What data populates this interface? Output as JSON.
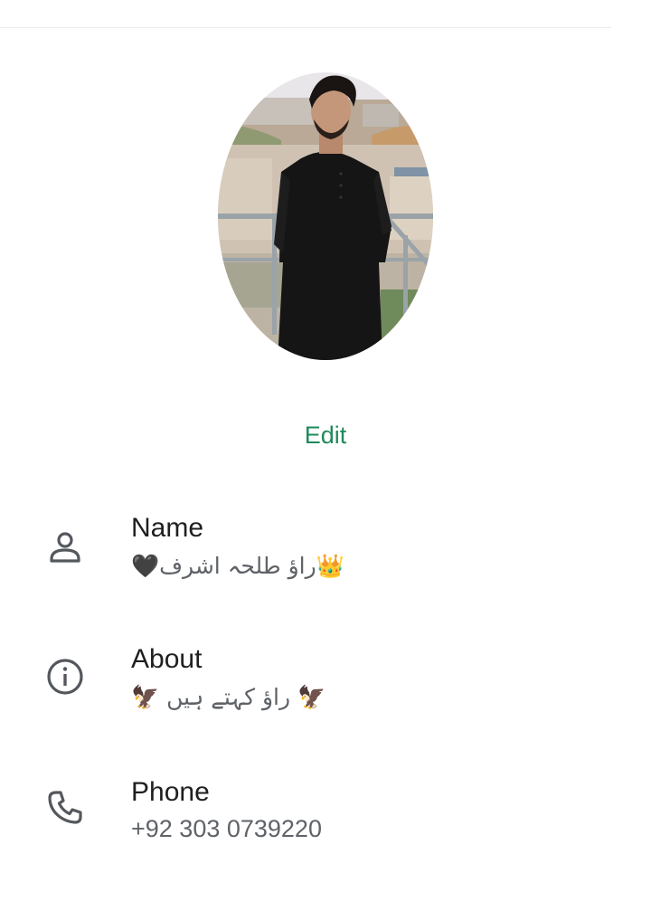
{
  "profile": {
    "photo_alt": "Profile photo",
    "edit_label": "Edit"
  },
  "rows": {
    "name": {
      "label": "Name",
      "value": "🖤راؤ طلحہ اشرف👑",
      "icon": "person-icon"
    },
    "about": {
      "label": "About",
      "value": "🦅 راؤ کہتے ہیں 🦅",
      "icon": "info-icon"
    },
    "phone": {
      "label": "Phone",
      "value": "+92 303 0739220",
      "icon": "phone-icon"
    }
  },
  "colors": {
    "accent": "#1f8a5b",
    "label": "#1f1f1f",
    "secondary": "#5f6368",
    "icon": "#54585d"
  }
}
